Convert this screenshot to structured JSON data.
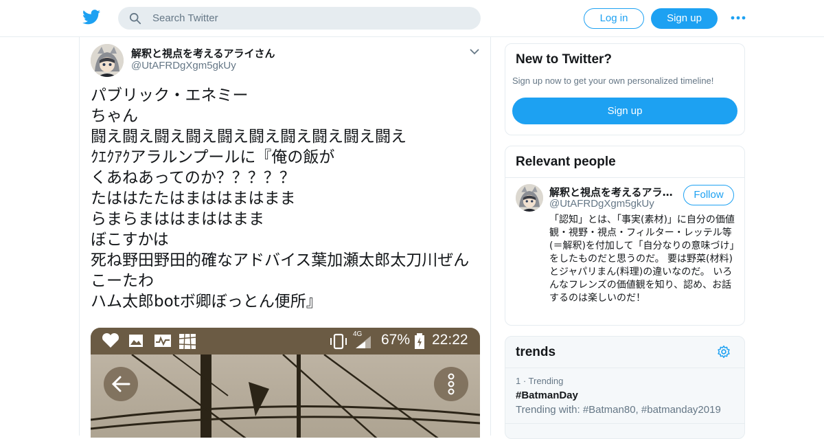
{
  "colors": {
    "brand": "#1da1f2",
    "text": "#14171a",
    "muted": "#657786",
    "border": "#e6ecf0"
  },
  "header": {
    "logo_icon": "twitter-bird-icon",
    "search_placeholder": "Search Twitter",
    "login_label": "Log in",
    "signup_label": "Sign up",
    "more_icon": "more-dots-icon"
  },
  "tweet": {
    "display_name": "解釈と視点を考えるアライさん",
    "handle": "@UtAFRDgXgm5gkUy",
    "lines": [
      "パブリック・エネミー",
      "ちゃん",
      "闘え闘え闘え闘え闘え闘え闘え闘え闘え闘え",
      "ｸｴｸｱｸアラルンプールに『俺の飯が",
      "くあねあってのか？？？？？",
      "たははたたはまははまはまま",
      "らまらまははまははまま",
      "ぼこすかは",
      "死ね野田野田的確なアドバイス葉加瀬太郎太刀川ぜん",
      "こーたわ",
      "ハム太郎botボ卿ぼっとん便所』"
    ],
    "media": {
      "status_battery": "67%",
      "status_time": "22:22",
      "status_network": "4G"
    }
  },
  "new_to_twitter": {
    "title": "New to Twitter?",
    "subtitle": "Sign up now to get your own personalized timeline!",
    "button": "Sign up"
  },
  "relevant_people": {
    "title": "Relevant people",
    "name": "解釈と視点を考えるアライさん",
    "handle": "@UtAFRDgXgm5gkUy",
    "follow_label": "Follow",
    "bio": "「認知」とは、「事実(素材)」に自分の価値観・視野・視点・フィルター・レッテル等(＝解釈)を付加して「自分なりの意味づけ」をしたものだと思うのだ。 要は野菜(材料)とジャパリまん(料理)の違いなのだ。 いろんなフレンズの価値観を知り、認め、お話するのは楽しいのだ！"
  },
  "trends": {
    "title": "trends",
    "items": [
      {
        "meta": "1 · Trending",
        "name": "#BatmanDay",
        "with": "Trending with: #Batman80, #batmanday2019"
      }
    ]
  }
}
